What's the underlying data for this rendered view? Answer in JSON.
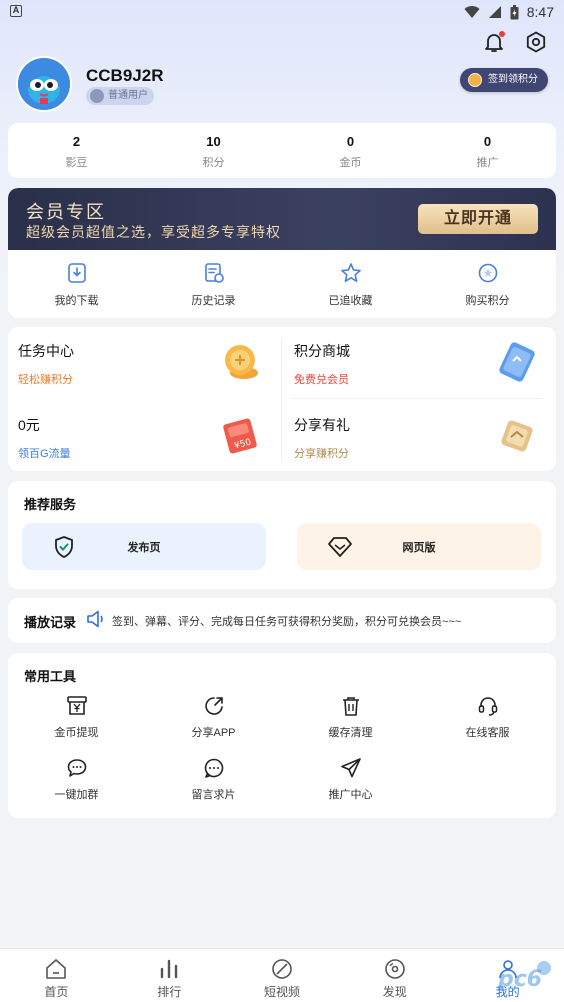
{
  "status_bar": {
    "time": "8:47",
    "left_icon": "A"
  },
  "header": {
    "icons": [
      "bell-icon",
      "settings-icon"
    ]
  },
  "profile": {
    "username": "CCB9J2R",
    "badge": "普通用户",
    "checkin_label": "签到领积分"
  },
  "stats": [
    {
      "value": "2",
      "label": "影豆"
    },
    {
      "value": "10",
      "label": "积分"
    },
    {
      "value": "0",
      "label": "金币"
    },
    {
      "value": "0",
      "label": "推广"
    }
  ],
  "vip": {
    "title": "会员专区",
    "subtitle": "超级会员超值之选，享受超多专享特权",
    "button": "立即开通"
  },
  "quick_actions": [
    {
      "label": "我的下载",
      "icon": "download-icon"
    },
    {
      "label": "历史记录",
      "icon": "history-icon"
    },
    {
      "label": "已追收藏",
      "icon": "star-icon"
    },
    {
      "label": "购买积分",
      "icon": "points-icon"
    }
  ],
  "tasks": [
    {
      "title": "任务中心",
      "subtitle": "轻松赚积分",
      "color": "#f07a2a"
    },
    {
      "title": "积分商城",
      "subtitle": "免费兑会员",
      "color": "#e8463c"
    },
    {
      "title": "0元",
      "subtitle": "领百G流量",
      "color": "#3b7ddd"
    },
    {
      "title": "分享有礼",
      "subtitle": "分享赚积分",
      "color": "#b08a50"
    }
  ],
  "recommend": {
    "title": "推荐服务",
    "buttons": [
      {
        "label": "发布页",
        "icon": "shield-check-icon",
        "bg": "#e9f2fd"
      },
      {
        "label": "网页版",
        "icon": "diamond-icon",
        "bg": "#fdf3e6"
      }
    ]
  },
  "history": {
    "title": "播放记录",
    "text": "签到、弹幕、评分、完成每日任务可获得积分奖励，积分可兑换会员~~~"
  },
  "tools": {
    "title": "常用工具",
    "items": [
      {
        "label": "金币提现",
        "icon": "yen-box-icon"
      },
      {
        "label": "分享APP",
        "icon": "share-icon"
      },
      {
        "label": "缓存清理",
        "icon": "trash-icon"
      },
      {
        "label": "在线客服",
        "icon": "headset-icon"
      },
      {
        "label": "一键加群",
        "icon": "chat-icon"
      },
      {
        "label": "留言求片",
        "icon": "message-icon"
      },
      {
        "label": "推广中心",
        "icon": "send-icon"
      }
    ]
  },
  "bottom_nav": [
    {
      "label": "首页",
      "icon": "home-icon"
    },
    {
      "label": "排行",
      "icon": "bar-chart-icon"
    },
    {
      "label": "短视频",
      "icon": "leaf-icon"
    },
    {
      "label": "发现",
      "icon": "disc-icon"
    },
    {
      "label": "我的",
      "icon": "user-icon",
      "active": true
    }
  ],
  "colors": {
    "accent": "#2d6ee6",
    "vip_gold": "#e0bf89",
    "vip_dark": "#2a2f4a"
  }
}
